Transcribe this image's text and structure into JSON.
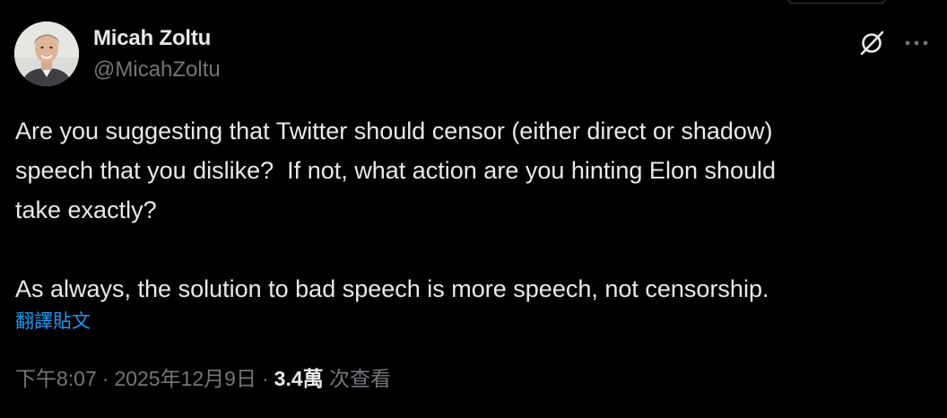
{
  "author": {
    "display_name": "Micah Zoltu",
    "handle": "@MicahZoltu",
    "avatar_icon": "user-avatar-photo"
  },
  "actions": {
    "grok_icon": "grok-icon",
    "more_icon": "more-horizontal-icon"
  },
  "tweet": {
    "text": "Are you suggesting that Twitter should censor (either direct or shadow)\nspeech that you dislike?  If not, what action are you hinting Elon should\ntake exactly?\n\nAs always, the solution to bad speech is more speech, not censorship.",
    "translate_label": "翻譯貼文"
  },
  "meta": {
    "time": "下午8:07",
    "date": "2025年12月9日",
    "separator": "·",
    "views_count": "3.4萬",
    "views_label": "次查看"
  },
  "colors": {
    "background": "#000000",
    "text_primary": "#e7e9ea",
    "text_secondary": "#71767b",
    "link": "#1d9bf0"
  }
}
